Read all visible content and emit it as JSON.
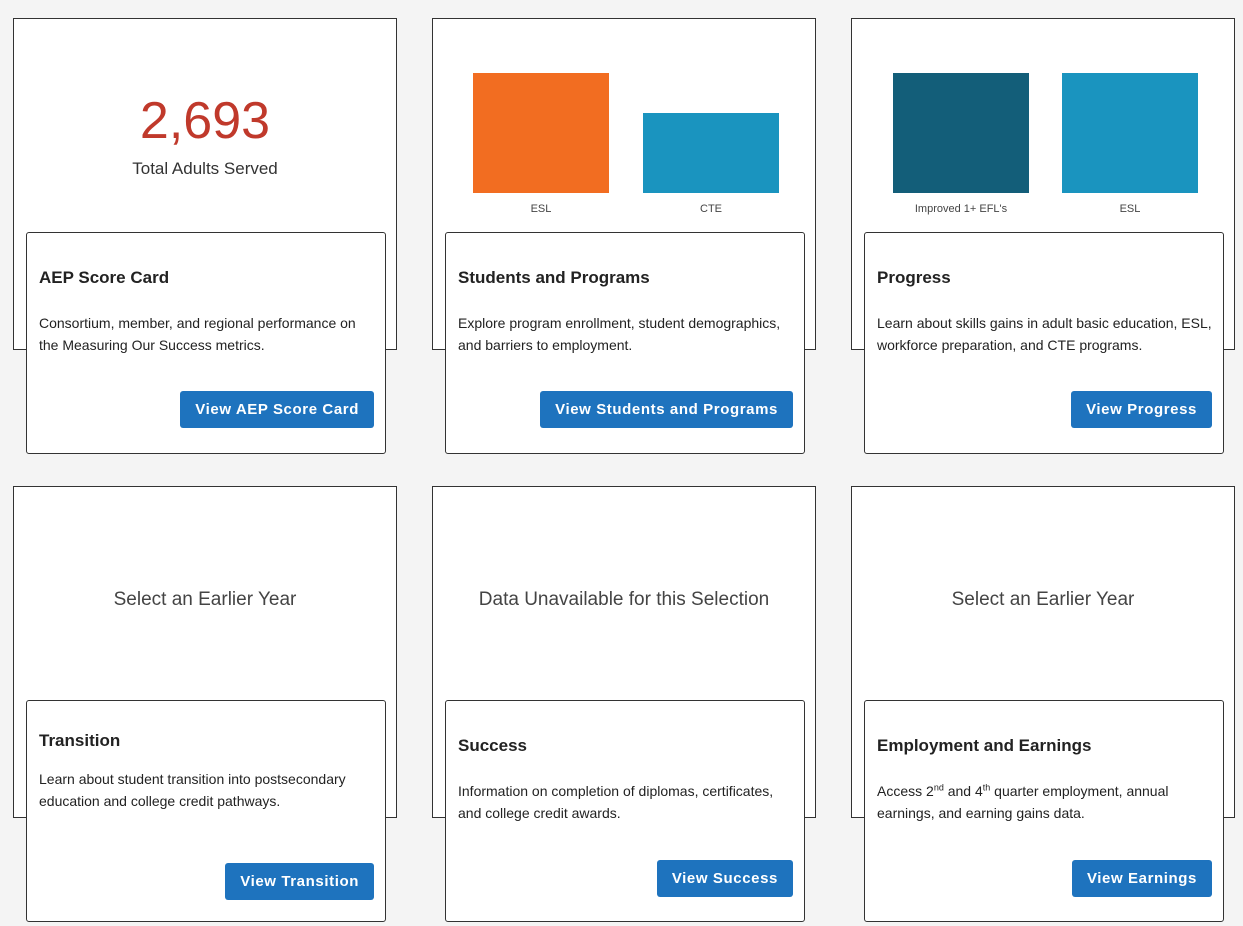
{
  "cards": [
    {
      "stat_value": "2,693",
      "stat_label": "Total Adults Served",
      "title": "AEP Score Card",
      "description": "Consortium, member, and regional performance on the Measuring Our Success metrics.",
      "button": "View AEP Score Card"
    },
    {
      "title": "Students and Programs",
      "description": "Explore program enrollment, student demographics, and barriers to employment.",
      "button": "View Students and Programs"
    },
    {
      "title": "Progress",
      "description": "Learn about skills gains in adult basic education, ESL, workforce preparation, and CTE programs.",
      "button": "View Progress"
    },
    {
      "message": "Select an Earlier Year",
      "title": "Transition",
      "description": "Learn about student transition into postsecondary education and college credit pathways.",
      "button": "View Transition"
    },
    {
      "message": "Data Unavailable for this Selection",
      "title": "Success",
      "description": "Information on completion of diplomas, certificates, and college credit awards.",
      "button": "View Success"
    },
    {
      "message": "Select an Earlier Year",
      "title": "Employment and Earnings",
      "description_parts": [
        "Access 2",
        "nd",
        " and 4",
        "th",
        " quarter employment, annual earnings, and earning gains data."
      ],
      "button": "View Earnings"
    }
  ],
  "chart_data": [
    {
      "type": "bar",
      "categories": [
        "ESL",
        "CTE"
      ],
      "values": [
        100,
        67
      ],
      "ylim": [
        0,
        100
      ],
      "colors": [
        "#f26d21",
        "#1a94bf"
      ]
    },
    {
      "type": "bar",
      "categories": [
        "Improved 1+ EFL's",
        "ESL"
      ],
      "values": [
        100,
        100
      ],
      "ylim": [
        0,
        100
      ],
      "colors": [
        "#135e79",
        "#1a94bf"
      ]
    }
  ],
  "colors": {
    "button": "#1e73be",
    "stat": "#c0392b"
  }
}
